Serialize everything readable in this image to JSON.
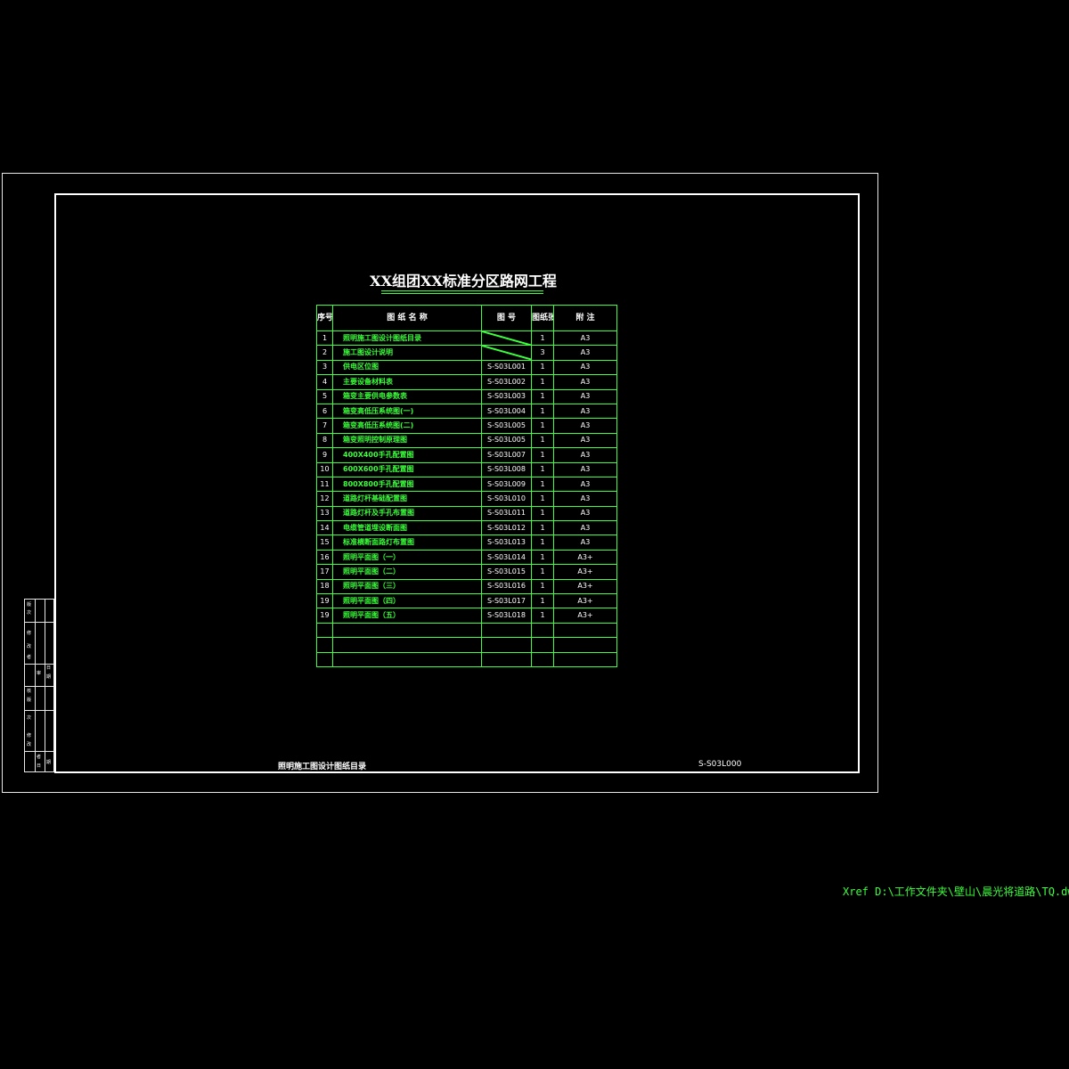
{
  "drawing": {
    "title": "XX组团XX标准分区路网工程",
    "footer_title": "照明施工图设计图纸目录",
    "footer_code": "S-S03L000",
    "xref": "Xref D:\\工作文件夹\\壁山\\晨光将道路\\TQ.dwg"
  },
  "table": {
    "headers": {
      "no": "序号",
      "name": "图 纸 名 称",
      "code": "图 号",
      "qty": "图纸张数",
      "note": "附 注"
    },
    "rows": [
      {
        "no": "1",
        "name": "照明施工图设计图纸目录",
        "code": "",
        "qty": "1",
        "note": "A3"
      },
      {
        "no": "2",
        "name": "施工图设计说明",
        "code": "",
        "qty": "3",
        "note": "A3"
      },
      {
        "no": "3",
        "name": "供电区位图",
        "code": "S-S03L001",
        "qty": "1",
        "note": "A3"
      },
      {
        "no": "4",
        "name": "主要设备材料表",
        "code": "S-S03L002",
        "qty": "1",
        "note": "A3"
      },
      {
        "no": "5",
        "name": "箱变主要供电参数表",
        "code": "S-S03L003",
        "qty": "1",
        "note": "A3"
      },
      {
        "no": "6",
        "name": "箱变高低压系统图(一)",
        "code": "S-S03L004",
        "qty": "1",
        "note": "A3"
      },
      {
        "no": "7",
        "name": "箱变高低压系统图(二)",
        "code": "S-S03L005",
        "qty": "1",
        "note": "A3"
      },
      {
        "no": "8",
        "name": "箱变照明控制原理图",
        "code": "S-S03L005",
        "qty": "1",
        "note": "A3"
      },
      {
        "no": "9",
        "name": "400X400手孔配置图",
        "code": "S-S03L007",
        "qty": "1",
        "note": "A3"
      },
      {
        "no": "10",
        "name": "600X600手孔配置图",
        "code": "S-S03L008",
        "qty": "1",
        "note": "A3"
      },
      {
        "no": "11",
        "name": "800X800手孔配置图",
        "code": "S-S03L009",
        "qty": "1",
        "note": "A3"
      },
      {
        "no": "12",
        "name": "道路灯杆基础配置图",
        "code": "S-S03L010",
        "qty": "1",
        "note": "A3"
      },
      {
        "no": "13",
        "name": "道路灯杆及手孔布置图",
        "code": "S-S03L011",
        "qty": "1",
        "note": "A3"
      },
      {
        "no": "14",
        "name": "电缆管道埋设断面图",
        "code": "S-S03L012",
        "qty": "1",
        "note": "A3"
      },
      {
        "no": "15",
        "name": "标准横断面路灯布置图",
        "code": "S-S03L013",
        "qty": "1",
        "note": "A3"
      },
      {
        "no": "16",
        "name": "照明平面图（一）",
        "code": "S-S03L014",
        "qty": "1",
        "note": "A3+"
      },
      {
        "no": "17",
        "name": "照明平面图（二）",
        "code": "S-S03L015",
        "qty": "1",
        "note": "A3+"
      },
      {
        "no": "18",
        "name": "照明平面图（三）",
        "code": "S-S03L016",
        "qty": "1",
        "note": "A3+"
      },
      {
        "no": "19",
        "name": "照明平面图（四）",
        "code": "S-S03L017",
        "qty": "1",
        "note": "A3+"
      },
      {
        "no": "19",
        "name": "照明平面图（五）",
        "code": "S-S03L018",
        "qty": "1",
        "note": "A3+"
      }
    ],
    "empty_rows": 3
  },
  "revision_box": {
    "labels": [
      "版",
      "次",
      "修",
      "改",
      "者",
      "日",
      "期",
      "审",
      "核",
      "版",
      "次",
      "修",
      "改",
      "者",
      "日",
      "期"
    ]
  }
}
